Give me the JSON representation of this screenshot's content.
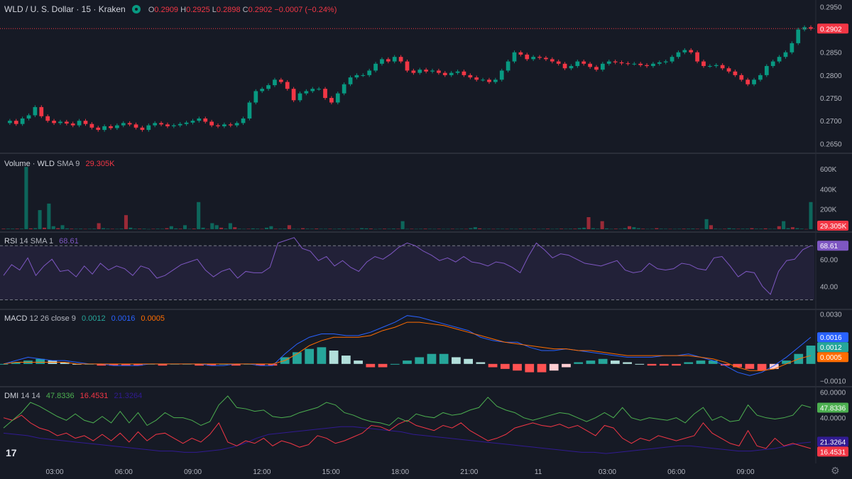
{
  "header": {
    "symbol_title": "WLD / U. S. Dollar · 15 · Kraken",
    "open_label": "O",
    "open_value": "0.2909",
    "high_label": "H",
    "high_value": "0.2925",
    "low_label": "L",
    "low_value": "0.2898",
    "close_label": "C",
    "close_value": "0.2902",
    "change_value": "−0.0007 (−0.24%)",
    "status_icon": "market-open-icon"
  },
  "panes": {
    "volume": {
      "label": "Volume · WLD",
      "params": "SMA 9",
      "value": "29.305K"
    },
    "rsi": {
      "label": "RSI",
      "params": "14 SMA 1",
      "value": "68.61"
    },
    "macd": {
      "label": "MACD",
      "params": "12 26 close 9",
      "v1": "0.0012",
      "v2": "0.0016",
      "v3": "0.0005"
    },
    "dmi": {
      "label": "DMI",
      "params": "14 14",
      "v1": "47.8336",
      "v2": "16.4531",
      "v3": "21.3264"
    }
  },
  "icons": {
    "logo": "tradingview-logo-icon",
    "settings": "gear-icon"
  },
  "logo_text": "17",
  "colors": {
    "background": "#161a25",
    "up": "#089981",
    "down": "#f23645",
    "rsi": "#7e57c2",
    "macd": "#2962ff",
    "signal": "#ff6d00",
    "dmi_plus": "#4caf50",
    "dmi_minus": "#f23645",
    "adx": "#311b92"
  },
  "chart_data": [
    {
      "type": "candlestick",
      "x_tick_labels": [
        "03:00",
        "06:00",
        "09:00",
        "12:00",
        "15:00",
        "18:00",
        "21:00",
        "11",
        "03:00",
        "06:00",
        "09:00"
      ],
      "price_axis_labels": [
        "0.2950",
        "0.2900",
        "0.2850",
        "0.2800",
        "0.2750",
        "0.2700",
        "0.2650"
      ],
      "ylim": [
        0.2635,
        0.296
      ],
      "last_price_label": "0.2902",
      "price_line": [
        0.2695,
        0.27,
        0.2693,
        0.2705,
        0.2712,
        0.273,
        0.271,
        0.27,
        0.2695,
        0.2698,
        0.2694,
        0.269,
        0.27,
        0.2693,
        0.2685,
        0.268,
        0.2688,
        0.2684,
        0.269,
        0.2695,
        0.2692,
        0.2685,
        0.268,
        0.269,
        0.2695,
        0.2692,
        0.2688,
        0.269,
        0.2693,
        0.2696,
        0.27,
        0.2705,
        0.2698,
        0.269,
        0.2688,
        0.2692,
        0.269,
        0.2695,
        0.2705,
        0.274,
        0.2765,
        0.277,
        0.2778,
        0.279,
        0.2785,
        0.277,
        0.2745,
        0.276,
        0.2765,
        0.277,
        0.277,
        0.275,
        0.274,
        0.276,
        0.278,
        0.2795,
        0.28,
        0.28,
        0.281,
        0.2825,
        0.2835,
        0.283,
        0.284,
        0.283,
        0.281,
        0.2805,
        0.2812,
        0.2808,
        0.281,
        0.2805,
        0.28,
        0.2805,
        0.2808,
        0.28,
        0.2795,
        0.279,
        0.279,
        0.2785,
        0.279,
        0.281,
        0.283,
        0.285,
        0.2845,
        0.2835,
        0.284,
        0.2838,
        0.2835,
        0.283,
        0.2825,
        0.2815,
        0.282,
        0.283,
        0.2825,
        0.2818,
        0.2812,
        0.2825,
        0.283,
        0.2828,
        0.2826,
        0.2825,
        0.2825,
        0.2822,
        0.282,
        0.2825,
        0.2828,
        0.283,
        0.284,
        0.285,
        0.2855,
        0.285,
        0.283,
        0.282,
        0.282,
        0.2822,
        0.2815,
        0.2808,
        0.28,
        0.279,
        0.278,
        0.279,
        0.28,
        0.282,
        0.283,
        0.284,
        0.285,
        0.287,
        0.29,
        0.2905,
        0.2902
      ]
    },
    {
      "type": "bar",
      "name": "Volume",
      "axis_labels": [
        "600K",
        "400K",
        "200K"
      ],
      "ylim": [
        0,
        720
      ],
      "values": [
        5,
        5,
        5,
        5,
        5,
        620,
        8,
        10,
        190,
        15,
        255,
        30,
        10,
        40,
        8,
        5,
        4,
        5,
        3,
        4,
        5,
        60,
        10,
        5,
        4,
        3,
        5,
        140,
        15,
        5,
        5,
        5,
        2,
        4,
        5,
        4,
        10,
        30,
        8,
        5,
        40,
        4,
        6,
        270,
        15,
        3,
        60,
        40,
        15,
        6,
        60,
        20,
        5,
        3,
        4,
        8,
        5,
        3,
        15,
        30,
        4,
        5,
        6,
        40,
        4,
        3,
        10,
        5,
        4,
        6,
        4,
        4,
        4,
        3,
        5,
        4,
        3,
        4,
        3,
        10,
        8,
        6,
        2,
        4,
        5,
        4,
        6,
        4,
        80,
        3,
        4,
        3,
        4,
        5,
        4,
        3,
        4,
        3,
        3,
        4,
        3,
        4,
        3,
        10,
        20,
        8,
        3,
        4,
        3,
        4,
        4,
        3,
        4,
        3,
        4,
        3,
        4,
        4,
        3,
        4,
        5,
        3,
        4,
        5,
        4,
        5,
        5,
        10,
        15,
        120,
        10,
        5,
        80,
        8,
        3,
        5,
        4,
        10,
        30,
        20,
        10,
        5,
        3,
        4,
        10,
        5,
        4,
        3,
        3,
        4,
        5,
        5,
        6,
        4,
        3,
        100,
        40,
        5,
        3,
        4,
        10,
        6,
        4,
        5,
        5,
        10,
        5,
        5,
        8,
        4,
        4,
        30,
        80,
        10,
        20,
        10,
        5,
        2,
        270
      ]
    },
    {
      "type": "line",
      "name": "RSI",
      "axis_labels": [
        "60.00",
        "40.00"
      ],
      "ylim": [
        25,
        78
      ],
      "values": [
        48,
        56,
        52,
        61,
        48,
        55,
        60,
        51,
        52,
        47,
        55,
        49,
        57,
        52,
        55,
        53,
        48,
        55,
        53,
        46,
        48,
        52,
        56,
        58,
        60,
        52,
        47,
        51,
        53,
        46,
        51,
        50,
        50,
        54,
        72,
        74,
        76,
        68,
        66,
        59,
        62,
        55,
        59,
        54,
        51,
        58,
        62,
        60,
        64,
        69,
        72,
        70,
        66,
        63,
        59,
        61,
        58,
        62,
        58,
        57,
        55,
        58,
        57,
        54,
        50,
        62,
        72,
        67,
        61,
        64,
        63,
        60,
        57,
        56,
        55,
        57,
        59,
        52,
        50,
        51,
        57,
        53,
        52,
        53,
        57,
        56,
        53,
        52,
        61,
        62,
        55,
        47,
        51,
        50,
        40,
        34,
        51,
        59,
        60,
        67,
        70
      ]
    },
    {
      "type": "line",
      "name": "MACD",
      "axis_labels": [
        "0.0030",
        "−0.0010"
      ],
      "ylim": [
        -0.0012,
        0.0031
      ],
      "macd_line": [
        0.0,
        0.0002,
        0.0004,
        0.0003,
        0.0002,
        0.0002,
        0.0001,
        0.0,
        0.0,
        -0.0001,
        -0.0001,
        -0.0001,
        0.0,
        0.0,
        0.0,
        0.0,
        0.0,
        -0.0001,
        -0.0001,
        0.0,
        0.0,
        -0.0001,
        -0.0001,
        0.0006,
        0.0012,
        0.0016,
        0.0018,
        0.0018,
        0.0017,
        0.0017,
        0.0019,
        0.0022,
        0.0025,
        0.0029,
        0.0028,
        0.0026,
        0.0024,
        0.0022,
        0.002,
        0.0016,
        0.0014,
        0.0013,
        0.0013,
        0.001,
        0.0008,
        0.0008,
        0.0009,
        0.0008,
        0.0007,
        0.0006,
        0.0005,
        0.0004,
        0.0004,
        0.0004,
        0.0005,
        0.0005,
        0.0006,
        0.0004,
        0.0002,
        -0.0001,
        -0.0005,
        -0.0007,
        -0.0005,
        -0.0001,
        0.0004,
        0.001,
        0.0016
      ],
      "signal_line": [
        0.0,
        0.0001,
        0.0001,
        0.0001,
        0.0001,
        0.0001,
        0.0,
        0.0,
        0.0,
        0.0,
        0.0,
        0.0,
        0.0,
        0.0,
        0.0,
        0.0,
        0.0,
        0.0,
        0.0,
        0.0,
        0.0,
        0.0,
        0.0,
        0.0002,
        0.0006,
        0.0011,
        0.0014,
        0.0016,
        0.0016,
        0.0016,
        0.0017,
        0.002,
        0.0022,
        0.0025,
        0.0025,
        0.0024,
        0.0023,
        0.0021,
        0.0019,
        0.0017,
        0.0015,
        0.0013,
        0.0012,
        0.0011,
        0.001,
        0.0009,
        0.0009,
        0.0008,
        0.0008,
        0.0007,
        0.0006,
        0.0005,
        0.0005,
        0.0005,
        0.0005,
        0.0005,
        0.0005,
        0.0004,
        0.0003,
        0.0001,
        -0.0002,
        -0.0004,
        -0.0004,
        -0.0003,
        0.0,
        0.0003,
        0.0005
      ],
      "histogram": [
        0.0,
        0.0001,
        0.0002,
        0.0003,
        0.0002,
        0.0001,
        0.0,
        0.0,
        -0.0001,
        -0.0001,
        -0.0001,
        -0.0001,
        0.0,
        -0.0001,
        0.0,
        0.0,
        -0.0001,
        -0.0001,
        0.0,
        -0.0001,
        0.0,
        -0.0001,
        -0.0001,
        0.0004,
        0.0007,
        0.0009,
        0.001,
        0.0008,
        0.0005,
        0.0002,
        -0.0002,
        -0.0002,
        0.0,
        0.0002,
        0.0004,
        0.0006,
        0.0006,
        0.0004,
        0.0003,
        0.0001,
        -0.0002,
        -0.0003,
        -0.0004,
        -0.0005,
        -0.0005,
        -0.0004,
        -0.0002,
        0.0001,
        0.0002,
        0.0003,
        0.0002,
        0.0001,
        0.0,
        -0.0001,
        -0.0001,
        -0.0001,
        0.0001,
        0.0002,
        0.0002,
        -0.0001,
        -0.0002,
        -0.0003,
        -0.0004,
        -0.0003,
        0.0002,
        0.0006,
        0.0011
      ]
    },
    {
      "type": "line",
      "name": "DMI",
      "axis_labels": [
        "60.0000",
        "40.0000"
      ],
      "ylim": [
        6,
        62
      ],
      "plus_di": [
        32,
        38,
        44,
        52,
        49,
        45,
        41,
        38,
        43,
        38,
        36,
        41,
        36,
        45,
        36,
        44,
        34,
        38,
        44,
        40,
        40,
        38,
        34,
        37,
        50,
        57,
        48,
        47,
        45,
        46,
        41,
        40,
        41,
        44,
        46,
        48,
        52,
        50,
        44,
        42,
        39,
        37,
        36,
        34,
        40,
        37,
        43,
        41,
        40,
        44,
        42,
        43,
        46,
        48,
        56,
        49,
        46,
        44,
        40,
        38,
        40,
        42,
        44,
        43,
        40,
        37,
        40,
        44,
        40,
        48,
        40,
        38,
        40,
        39,
        38,
        40,
        36,
        43,
        48,
        38,
        41,
        37,
        38,
        50,
        42,
        40,
        39,
        40,
        42,
        50,
        48
      ],
      "minus_di": [
        40,
        38,
        42,
        36,
        32,
        30,
        26,
        28,
        24,
        26,
        22,
        27,
        22,
        28,
        21,
        29,
        22,
        27,
        28,
        24,
        20,
        24,
        21,
        27,
        36,
        21,
        18,
        22,
        20,
        24,
        18,
        22,
        20,
        17,
        19,
        26,
        24,
        20,
        22,
        25,
        28,
        34,
        33,
        30,
        35,
        38,
        34,
        32,
        30,
        34,
        32,
        36,
        30,
        26,
        22,
        24,
        27,
        32,
        34,
        36,
        34,
        33,
        35,
        32,
        34,
        30,
        26,
        34,
        32,
        24,
        20,
        24,
        22,
        26,
        24,
        22,
        24,
        26,
        36,
        28,
        24,
        20,
        18,
        30,
        18,
        16,
        24,
        18,
        20,
        18,
        16
      ],
      "adx": [
        28,
        27,
        26,
        24,
        23,
        22,
        21,
        20,
        19,
        18,
        17,
        16,
        15,
        14,
        14,
        13,
        13,
        14,
        15,
        17,
        20,
        24,
        27,
        28,
        29,
        30,
        31,
        32,
        33,
        33,
        32,
        31,
        30,
        29,
        27,
        26,
        25,
        24,
        23,
        22,
        21,
        20,
        19,
        18,
        17,
        16,
        15,
        14,
        13,
        13,
        12,
        13,
        14,
        15,
        16,
        17,
        18,
        18,
        17,
        16,
        15,
        14,
        14,
        15,
        16,
        18,
        20,
        21
      ]
    }
  ]
}
